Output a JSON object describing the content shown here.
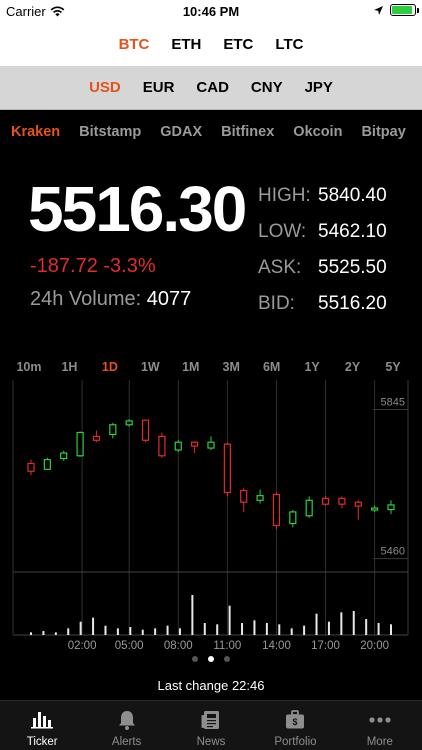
{
  "status_bar": {
    "carrier": "Carrier",
    "time": "10:46 PM",
    "battery_level": 0.9
  },
  "coins": [
    {
      "label": "BTC",
      "selected": true
    },
    {
      "label": "ETH",
      "selected": false
    },
    {
      "label": "ETC",
      "selected": false
    },
    {
      "label": "LTC",
      "selected": false
    }
  ],
  "currencies": [
    {
      "label": "USD",
      "selected": true
    },
    {
      "label": "EUR",
      "selected": false
    },
    {
      "label": "CAD",
      "selected": false
    },
    {
      "label": "CNY",
      "selected": false
    },
    {
      "label": "JPY",
      "selected": false
    }
  ],
  "exchanges": [
    {
      "label": "Kraken",
      "selected": true
    },
    {
      "label": "Bitstamp",
      "selected": false
    },
    {
      "label": "GDAX",
      "selected": false
    },
    {
      "label": "Bitfinex",
      "selected": false
    },
    {
      "label": "Okcoin",
      "selected": false
    },
    {
      "label": "Bitpay",
      "selected": false
    }
  ],
  "ticker": {
    "price": "5516.30",
    "change": "-187.72 -3.3%",
    "volume_label": "24h Volume:",
    "volume_value": "4077",
    "high_label": "HIGH:",
    "high": "5840.40",
    "low_label": "LOW:",
    "low": "5462.10",
    "ask_label": "ASK:",
    "ask": "5525.50",
    "bid_label": "BID:",
    "bid": "5516.20"
  },
  "ranges": [
    {
      "label": "10m",
      "selected": false
    },
    {
      "label": "1H",
      "selected": false
    },
    {
      "label": "1D",
      "selected": true
    },
    {
      "label": "1W",
      "selected": false
    },
    {
      "label": "1M",
      "selected": false
    },
    {
      "label": "3M",
      "selected": false
    },
    {
      "label": "6M",
      "selected": false
    },
    {
      "label": "1Y",
      "selected": false
    },
    {
      "label": "2Y",
      "selected": false
    },
    {
      "label": "5Y",
      "selected": false
    }
  ],
  "chart_data": {
    "type": "candlestick",
    "ylim": [
      5410,
      5880
    ],
    "price_labels": [
      "5845",
      "5460"
    ],
    "price_label_values": [
      5845,
      5460
    ],
    "x_tick_labels": [
      "02:00",
      "05:00",
      "08:00",
      "11:00",
      "14:00",
      "17:00",
      "20:00"
    ],
    "x_tick_positions": [
      3,
      6,
      9,
      12,
      15,
      18,
      21
    ],
    "candles": [
      {
        "o": 5685,
        "c": 5665,
        "h": 5695,
        "l": 5655
      },
      {
        "o": 5670,
        "c": 5695,
        "h": 5700,
        "l": 5668
      },
      {
        "o": 5698,
        "c": 5712,
        "h": 5718,
        "l": 5692
      },
      {
        "o": 5705,
        "c": 5765,
        "h": 5768,
        "l": 5702
      },
      {
        "o": 5755,
        "c": 5745,
        "h": 5770,
        "l": 5740
      },
      {
        "o": 5760,
        "c": 5785,
        "h": 5790,
        "l": 5750
      },
      {
        "o": 5785,
        "c": 5795,
        "h": 5800,
        "l": 5780
      },
      {
        "o": 5797,
        "c": 5745,
        "h": 5798,
        "l": 5740
      },
      {
        "o": 5755,
        "c": 5705,
        "h": 5765,
        "l": 5700
      },
      {
        "o": 5720,
        "c": 5740,
        "h": 5745,
        "l": 5715
      },
      {
        "o": 5740,
        "c": 5730,
        "h": 5742,
        "l": 5712
      },
      {
        "o": 5725,
        "c": 5740,
        "h": 5755,
        "l": 5720
      },
      {
        "o": 5735,
        "c": 5610,
        "h": 5740,
        "l": 5600
      },
      {
        "o": 5615,
        "c": 5585,
        "h": 5622,
        "l": 5560
      },
      {
        "o": 5590,
        "c": 5602,
        "h": 5618,
        "l": 5582
      },
      {
        "o": 5605,
        "c": 5525,
        "h": 5610,
        "l": 5515
      },
      {
        "o": 5530,
        "c": 5560,
        "h": 5565,
        "l": 5520
      },
      {
        "o": 5550,
        "c": 5590,
        "h": 5600,
        "l": 5545
      },
      {
        "o": 5595,
        "c": 5580,
        "h": 5602,
        "l": 5575
      },
      {
        "o": 5595,
        "c": 5580,
        "h": 5600,
        "l": 5570
      },
      {
        "o": 5585,
        "c": 5575,
        "h": 5590,
        "l": 5540
      },
      {
        "o": 5565,
        "c": 5570,
        "h": 5576,
        "l": 5560
      },
      {
        "o": 5566,
        "c": 5578,
        "h": 5590,
        "l": 5555
      }
    ],
    "volumes": [
      2,
      3,
      2,
      5,
      10,
      13,
      7,
      5,
      6,
      4,
      5,
      7,
      5,
      30,
      9,
      8,
      22,
      9,
      11,
      9,
      8,
      5,
      7,
      16,
      10,
      17,
      18,
      12,
      9,
      8
    ],
    "volume_max": 30
  },
  "pager": {
    "count": 3,
    "active": 1
  },
  "last_change": "Last change 22:46",
  "tabs": [
    {
      "label": "Ticker",
      "icon": "bar-chart-icon",
      "selected": true
    },
    {
      "label": "Alerts",
      "icon": "bell-icon",
      "selected": false
    },
    {
      "label": "News",
      "icon": "newspaper-icon",
      "selected": false
    },
    {
      "label": "Portfolio",
      "icon": "briefcase-icon",
      "selected": false
    },
    {
      "label": "More",
      "icon": "more-dots-icon",
      "selected": false
    }
  ],
  "colors": {
    "accent": "#e4531b",
    "up": "#2bd13a",
    "down": "#e22b2b"
  }
}
